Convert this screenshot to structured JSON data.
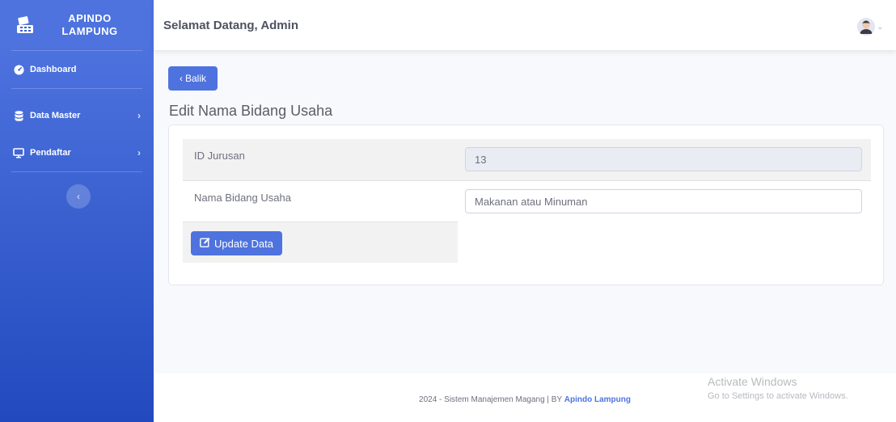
{
  "brand": {
    "line1": "APINDO",
    "line2": "LAMPUNG",
    "icon": "cash-register-icon"
  },
  "sidebar": {
    "items": [
      {
        "label": "Dashboard",
        "icon": "tachometer-icon"
      },
      {
        "label": "Data Master",
        "icon": "database-icon"
      },
      {
        "label": "Pendaftar",
        "icon": "desktop-icon"
      }
    ]
  },
  "topbar": {
    "welcome": "Selamat Datang, Admin"
  },
  "page": {
    "back_label": "Balik",
    "title": "Edit Nama Bidang Usaha",
    "form": {
      "id_label": "ID Jurusan",
      "id_value": "13",
      "name_label": "Nama Bidang Usaha",
      "name_value": "Makanan atau Minuman",
      "update_label": "Update Data"
    }
  },
  "footer": {
    "text": "2024 - Sistem Manajemen Magang | BY",
    "link": "Apindo Lampung"
  },
  "watermark": {
    "line1": "Activate Windows",
    "line2": "Go to Settings to activate Windows."
  },
  "colors": {
    "primary": "#4e73df",
    "primary_dark": "#224abe",
    "bg": "#f8f9fc"
  }
}
